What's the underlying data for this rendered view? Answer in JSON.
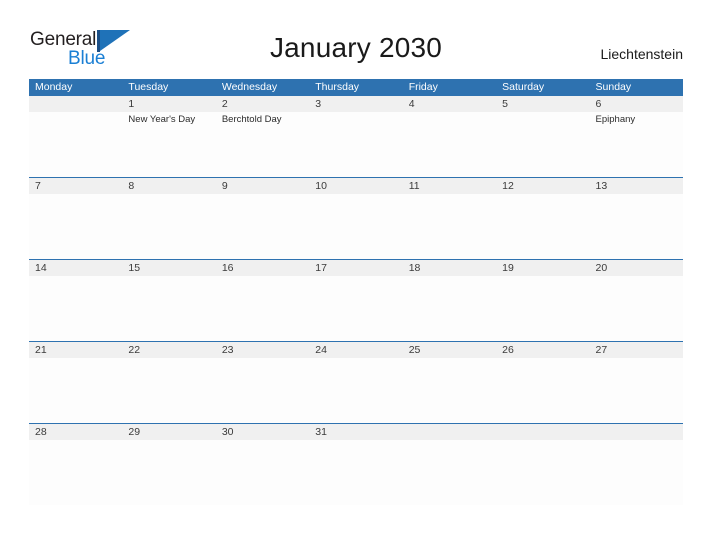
{
  "brand": {
    "name_part1": "General",
    "name_part2": "Blue",
    "flag_icon": "flag-triangle-icon",
    "accent_color": "#1f72b8",
    "text_color": "#231f20",
    "blue_text_color": "#1a7fd4"
  },
  "header": {
    "title": "January 2030",
    "region": "Liechtenstein",
    "header_bar_color": "#2e72b0",
    "band_color": "#f0f0f0"
  },
  "calendar": {
    "weekday_headers": [
      "Monday",
      "Tuesday",
      "Wednesday",
      "Thursday",
      "Friday",
      "Saturday",
      "Sunday"
    ],
    "weeks": [
      [
        {
          "date": "",
          "events": []
        },
        {
          "date": "1",
          "events": [
            "New Year's Day"
          ]
        },
        {
          "date": "2",
          "events": [
            "Berchtold Day"
          ]
        },
        {
          "date": "3",
          "events": []
        },
        {
          "date": "4",
          "events": []
        },
        {
          "date": "5",
          "events": []
        },
        {
          "date": "6",
          "events": [
            "Epiphany"
          ]
        }
      ],
      [
        {
          "date": "7",
          "events": []
        },
        {
          "date": "8",
          "events": []
        },
        {
          "date": "9",
          "events": []
        },
        {
          "date": "10",
          "events": []
        },
        {
          "date": "11",
          "events": []
        },
        {
          "date": "12",
          "events": []
        },
        {
          "date": "13",
          "events": []
        }
      ],
      [
        {
          "date": "14",
          "events": []
        },
        {
          "date": "15",
          "events": []
        },
        {
          "date": "16",
          "events": []
        },
        {
          "date": "17",
          "events": []
        },
        {
          "date": "18",
          "events": []
        },
        {
          "date": "19",
          "events": []
        },
        {
          "date": "20",
          "events": []
        }
      ],
      [
        {
          "date": "21",
          "events": []
        },
        {
          "date": "22",
          "events": []
        },
        {
          "date": "23",
          "events": []
        },
        {
          "date": "24",
          "events": []
        },
        {
          "date": "25",
          "events": []
        },
        {
          "date": "26",
          "events": []
        },
        {
          "date": "27",
          "events": []
        }
      ],
      [
        {
          "date": "28",
          "events": []
        },
        {
          "date": "29",
          "events": []
        },
        {
          "date": "30",
          "events": []
        },
        {
          "date": "31",
          "events": []
        },
        {
          "date": "",
          "events": []
        },
        {
          "date": "",
          "events": []
        },
        {
          "date": "",
          "events": []
        }
      ]
    ]
  }
}
